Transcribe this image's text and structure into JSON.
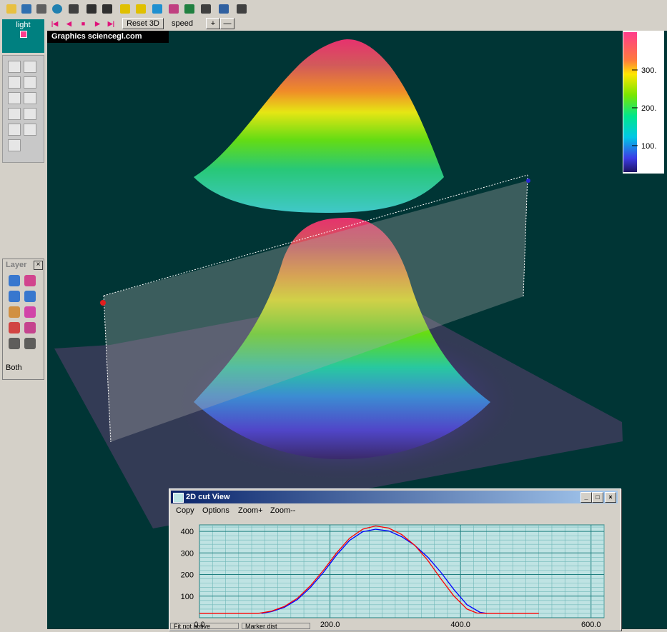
{
  "toolbar": {
    "icons": [
      "open-folder-icon",
      "save-icon",
      "print-icon",
      "globe-icon",
      "camera-icon",
      "zoom-in-icon",
      "zoom-out-icon",
      "light-a-icon",
      "light-b-icon",
      "sparkle-icon",
      "color-bars-icon",
      "contour-bars-icon",
      "tree-icon",
      "projector-icon",
      "tornado-icon"
    ]
  },
  "playback": {
    "reset_label": "Reset 3D",
    "speed_label": "speed",
    "plus_label": "+",
    "minus_label": "—"
  },
  "light_panel": {
    "label": "light"
  },
  "layer_panel": {
    "title": "Layer",
    "close": "×",
    "mode": "Both"
  },
  "view3d": {
    "brand": "Graphics sciencegl.com"
  },
  "colorbar": {
    "labels": [
      "300.",
      "200.",
      "100."
    ],
    "values": [
      300,
      200,
      100
    ],
    "range": [
      30,
      400
    ]
  },
  "cut_window": {
    "title": "2D cut View",
    "min_btn": "_",
    "max_btn": "□",
    "close_btn": "×",
    "menu": [
      "Copy",
      "Options",
      "Zoom+",
      "Zoom--"
    ]
  },
  "status": {
    "fit": "Fit not active",
    "marker": "Marker dist"
  },
  "chart_data": {
    "type": "line",
    "xlim": [
      0,
      620
    ],
    "ylim": [
      0,
      430
    ],
    "xticks": [
      "0.0",
      "200.0",
      "400.0",
      "600.0"
    ],
    "xtick_values": [
      0,
      200,
      400,
      600
    ],
    "yticks": [
      "400",
      "300",
      "200",
      "100"
    ],
    "ytick_values": [
      400,
      300,
      200,
      100
    ],
    "series": [
      {
        "color": "#0000ff",
        "x": [
          95,
          110,
          130,
          150,
          170,
          190,
          210,
          230,
          250,
          270,
          290,
          310,
          330,
          350,
          370,
          390,
          410,
          430,
          440
        ],
        "y": [
          20,
          28,
          48,
          84,
          140,
          210,
          290,
          358,
          398,
          410,
          402,
          375,
          335,
          280,
          210,
          130,
          60,
          25,
          20
        ]
      },
      {
        "color": "#ff0000",
        "x": [
          0,
          90,
          110,
          130,
          150,
          170,
          190,
          210,
          230,
          250,
          270,
          290,
          310,
          330,
          350,
          370,
          390,
          410,
          425,
          440,
          520
        ],
        "y": [
          20,
          20,
          30,
          52,
          90,
          148,
          220,
          300,
          368,
          410,
          425,
          415,
          385,
          335,
          265,
          180,
          100,
          40,
          22,
          20,
          20
        ]
      }
    ]
  }
}
